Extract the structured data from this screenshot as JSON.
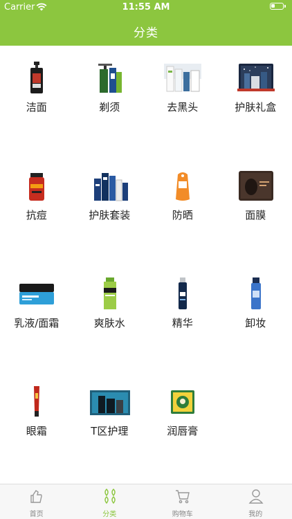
{
  "status_bar": {
    "carrier": "Carrier",
    "time": "11:55 AM"
  },
  "header": {
    "title": "分类"
  },
  "categories": [
    {
      "label": "洁面",
      "icon": "cleanser-bottle-icon"
    },
    {
      "label": "剃须",
      "icon": "razor-set-icon"
    },
    {
      "label": "去黑头",
      "icon": "blackhead-kit-icon"
    },
    {
      "label": "护肤礼盒",
      "icon": "gift-box-icon"
    },
    {
      "label": "抗痘",
      "icon": "acne-jar-icon"
    },
    {
      "label": "护肤套装",
      "icon": "skincare-set-icon"
    },
    {
      "label": "防晒",
      "icon": "sunscreen-icon"
    },
    {
      "label": "面膜",
      "icon": "face-mask-icon"
    },
    {
      "label": "乳液/面霜",
      "icon": "cream-jar-icon"
    },
    {
      "label": "爽肤水",
      "icon": "toner-bottle-icon"
    },
    {
      "label": "精华",
      "icon": "serum-bottle-icon"
    },
    {
      "label": "卸妆",
      "icon": "remover-bottle-icon"
    },
    {
      "label": "眼霜",
      "icon": "eye-cream-tube-icon"
    },
    {
      "label": "T区护理",
      "icon": "t-zone-kit-icon"
    },
    {
      "label": "润唇膏",
      "icon": "lip-balm-icon"
    }
  ],
  "tabbar": {
    "tabs": [
      {
        "label": "首页",
        "icon": "home-icon",
        "active": false
      },
      {
        "label": "分类",
        "icon": "category-icon",
        "active": true
      },
      {
        "label": "购物车",
        "icon": "cart-icon",
        "active": false
      },
      {
        "label": "我的",
        "icon": "profile-icon",
        "active": false
      }
    ]
  },
  "colors": {
    "accent": "#8cc63f",
    "tab_inactive": "#888888"
  }
}
